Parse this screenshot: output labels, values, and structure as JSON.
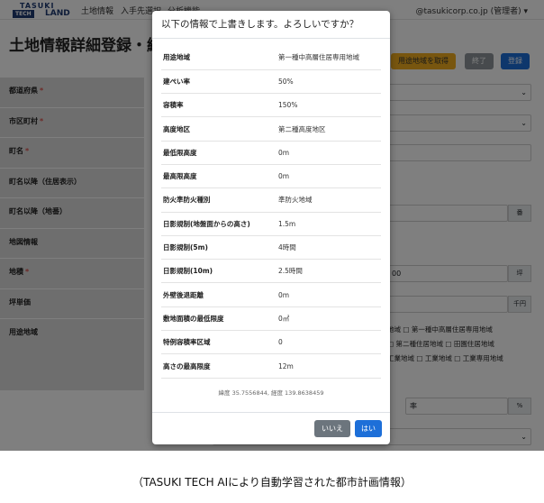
{
  "navbar": {
    "logo_top": "TASUKI",
    "logo_badge": "TECH",
    "logo_land": "LAND",
    "items": [
      "土地情報",
      "入手先選択",
      "分析機能"
    ],
    "user": "@tasukicorp.co.jp (管理者) ▾"
  },
  "page": {
    "title": "土地情報詳細登録・編",
    "buttons": {
      "fetch_zoning": "用途地域を取得",
      "end": "終了",
      "register": "登録"
    },
    "form_rows": [
      {
        "label": "都道府県",
        "required": "*"
      },
      {
        "label": "市区町村",
        "required": "*"
      },
      {
        "label": "町名",
        "required": "*"
      },
      {
        "label": "町名以降（住居表示）",
        "required": ""
      },
      {
        "label": "町名以降（地番）",
        "required": ""
      },
      {
        "label": "地図情報",
        "required": ""
      },
      {
        "label": "地積",
        "required": "*"
      },
      {
        "label": "坪単価",
        "required": ""
      },
      {
        "label": "用途地域",
        "required": ""
      }
    ],
    "field_values": {
      "lot_addon": "番",
      "area_value": "00",
      "area_unit": "坪",
      "price_unit": "千円",
      "pct_label": "率",
      "pct_unit": "%"
    },
    "zoning_checks": [
      "地域 □ 第一種中高層住居専用地域",
      "□ 第二種住居地域 □ 田園住居地域",
      "工業地域 □ 工業地域 □ 工業専用地域"
    ]
  },
  "modal": {
    "title": "以下の情報で上書きします。よろしいですか？",
    "rows": [
      {
        "key": "用途地域",
        "value": "第一種中高層住居専用地域"
      },
      {
        "key": "建ぺい率",
        "value": "50%"
      },
      {
        "key": "容積率",
        "value": "150%"
      },
      {
        "key": "高度地区",
        "value": "第二種高度地区"
      },
      {
        "key": "最低限高度",
        "value": "0m"
      },
      {
        "key": "最高限高度",
        "value": "0m"
      },
      {
        "key": "防火準防火種別",
        "value": "準防火地域"
      },
      {
        "key": "日影規制(地盤面からの高さ)",
        "value": "1.5m"
      },
      {
        "key": "日影規制(5m)",
        "value": "4時間"
      },
      {
        "key": "日影規制(10m)",
        "value": "2.5時間"
      },
      {
        "key": "外壁後退距離",
        "value": "0m"
      },
      {
        "key": "敷地面積の最低限度",
        "value": "0㎡"
      },
      {
        "key": "特例容積率区域",
        "value": "0"
      },
      {
        "key": "高さの最高限度",
        "value": "12m"
      }
    ],
    "coords": "緯度 35.7556844, 経度 139.8638459",
    "buttons": {
      "no": "いいえ",
      "yes": "はい"
    }
  },
  "caption": "（TASUKI TECH AIにより自動学習された都市計画情報）",
  "colors": {
    "primary": "#1d6fd8",
    "secondary": "#6c757d",
    "warning": "#f0ad1e",
    "label_bg": "#dcdcdc"
  }
}
